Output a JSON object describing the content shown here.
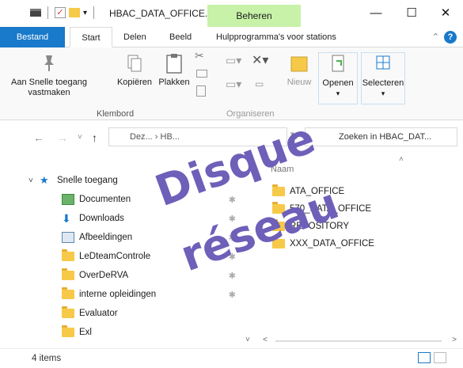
{
  "window": {
    "title": "HBAC_DATA_OFFICE...",
    "contextual_tab": "Beheren",
    "controls": [
      "—",
      "☐",
      "✕"
    ]
  },
  "tabs": [
    "Bestand",
    "Start",
    "Delen",
    "Beeld",
    "Hulpprogramma's voor stations"
  ],
  "ribbon": {
    "pin_label_1": "Aan Snelle toegang",
    "pin_label_2": "vastmaken",
    "copy_label": "Kopiëren",
    "paste_label": "Plakken",
    "new_label": "Nieuw",
    "open_label": "Openen",
    "select_label": "Selecteren",
    "group_clipboard": "Klembord",
    "group_organize": "Organiseren"
  },
  "address": {
    "path": "Dez... › HB...",
    "search_placeholder": "Zoeken in HBAC_DAT..."
  },
  "tree": {
    "quick_access": "Snelle toegang",
    "items": [
      "Documenten",
      "Downloads",
      "Afbeeldingen",
      "LeDteamControle",
      "OverDeRVA",
      "interne opleidingen",
      "Evaluator",
      "Exl"
    ]
  },
  "files": {
    "column_name": "Naam",
    "items": [
      "ATA_OFFICE",
      "570_DATA_OFFICE",
      "REPOSITORY",
      "XXX_DATA_OFFICE"
    ]
  },
  "status": {
    "count": "4 items"
  },
  "overlay": {
    "line1": "Disque",
    "line2": "réseau"
  },
  "colors": {
    "accent": "#1979ca",
    "contextual_tab_bg": "#c7f2a8",
    "overlay_text": "#6e5fb9",
    "folder": "#f7c948"
  }
}
